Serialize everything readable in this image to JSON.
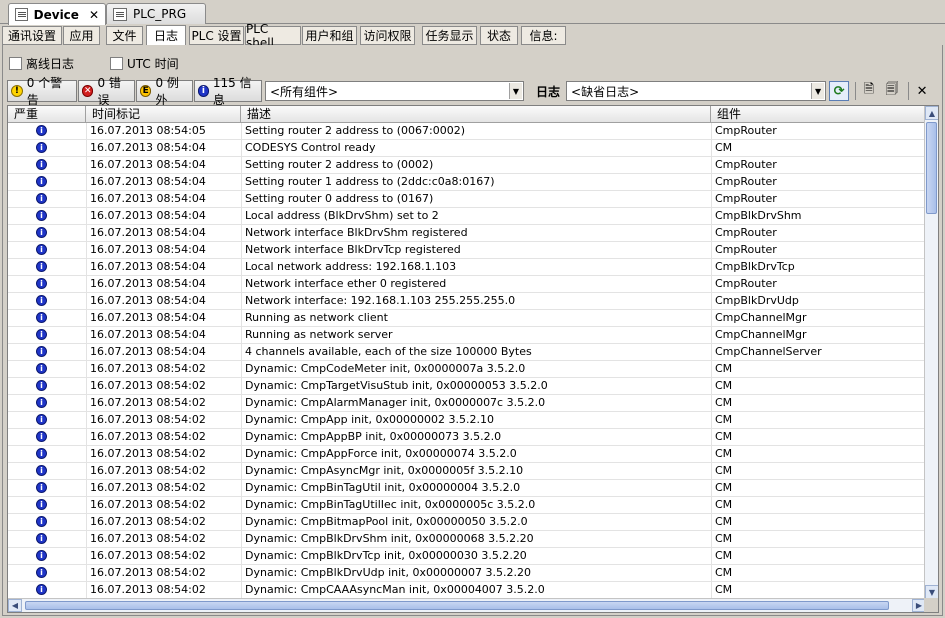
{
  "doc_tabs": [
    {
      "label": "Device",
      "close": "✕"
    },
    {
      "label": "PLC_PRG"
    }
  ],
  "inner_tabs": [
    "通讯设置",
    "应用",
    "文件",
    "日志",
    "PLC 设置",
    "PLC shell",
    "用户和组",
    "访问权限",
    "任务显示",
    "状态",
    "信息:"
  ],
  "active_inner_tab": "日志",
  "options": {
    "offline_log_label": "离线日志",
    "utc_time_label": "UTC 时间"
  },
  "counters": {
    "warnings": "0 个警告",
    "errors": "0 错误",
    "exceptions": "0 例外",
    "info": "115 信息"
  },
  "filter": {
    "component_value": "<所有组件>",
    "log_label": "日志",
    "log_value": "<缺省日志>"
  },
  "columns": [
    "严重",
    "时间标记",
    "描述",
    "组件"
  ],
  "colors": {
    "info_icon": "#1f35c8",
    "panel": "#d4d0c8"
  },
  "rows": [
    {
      "sev": "i",
      "time": "16.07.2013 08:54:05",
      "desc": "Setting router 2 address to (0067:0002)",
      "comp": "CmpRouter"
    },
    {
      "sev": "i",
      "time": "16.07.2013 08:54:04",
      "desc": "CODESYS Control ready",
      "comp": "CM"
    },
    {
      "sev": "i",
      "time": "16.07.2013 08:54:04",
      "desc": "Setting router 2 address to (0002)",
      "comp": "CmpRouter"
    },
    {
      "sev": "i",
      "time": "16.07.2013 08:54:04",
      "desc": "Setting router 1 address to (2ddc:c0a8:0167)",
      "comp": "CmpRouter"
    },
    {
      "sev": "i",
      "time": "16.07.2013 08:54:04",
      "desc": "Setting router 0 address to (0167)",
      "comp": "CmpRouter"
    },
    {
      "sev": "i",
      "time": "16.07.2013 08:54:04",
      "desc": "Local address (BlkDrvShm) set to 2",
      "comp": "CmpBlkDrvShm"
    },
    {
      "sev": "i",
      "time": "16.07.2013 08:54:04",
      "desc": "Network interface BlkDrvShm registered",
      "comp": "CmpRouter"
    },
    {
      "sev": "i",
      "time": "16.07.2013 08:54:04",
      "desc": "Network interface BlkDrvTcp registered",
      "comp": "CmpRouter"
    },
    {
      "sev": "i",
      "time": "16.07.2013 08:54:04",
      "desc": "Local network address: 192.168.1.103",
      "comp": "CmpBlkDrvTcp"
    },
    {
      "sev": "i",
      "time": "16.07.2013 08:54:04",
      "desc": "Network interface ether 0 registered",
      "comp": "CmpRouter"
    },
    {
      "sev": "i",
      "time": "16.07.2013 08:54:04",
      "desc": "Network interface: 192.168.1.103 255.255.255.0",
      "comp": "CmpBlkDrvUdp"
    },
    {
      "sev": "i",
      "time": "16.07.2013 08:54:04",
      "desc": "Running as network client",
      "comp": "CmpChannelMgr"
    },
    {
      "sev": "i",
      "time": "16.07.2013 08:54:04",
      "desc": "Running as network server",
      "comp": "CmpChannelMgr"
    },
    {
      "sev": "i",
      "time": "16.07.2013 08:54:04",
      "desc": "4 channels available, each of the size 100000 Bytes",
      "comp": "CmpChannelServer"
    },
    {
      "sev": "i",
      "time": "16.07.2013 08:54:02",
      "desc": "Dynamic: CmpCodeMeter init, 0x0000007a 3.5.2.0",
      "comp": "CM"
    },
    {
      "sev": "i",
      "time": "16.07.2013 08:54:02",
      "desc": "Dynamic: CmpTargetVisuStub init, 0x00000053 3.5.2.0",
      "comp": "CM"
    },
    {
      "sev": "i",
      "time": "16.07.2013 08:54:02",
      "desc": "Dynamic: CmpAlarmManager init, 0x0000007c 3.5.2.0",
      "comp": "CM"
    },
    {
      "sev": "i",
      "time": "16.07.2013 08:54:02",
      "desc": "Dynamic: CmpApp init, 0x00000002 3.5.2.10",
      "comp": "CM"
    },
    {
      "sev": "i",
      "time": "16.07.2013 08:54:02",
      "desc": "Dynamic: CmpAppBP init, 0x00000073 3.5.2.0",
      "comp": "CM"
    },
    {
      "sev": "i",
      "time": "16.07.2013 08:54:02",
      "desc": "Dynamic: CmpAppForce init, 0x00000074 3.5.2.0",
      "comp": "CM"
    },
    {
      "sev": "i",
      "time": "16.07.2013 08:54:02",
      "desc": "Dynamic: CmpAsyncMgr init, 0x0000005f 3.5.2.10",
      "comp": "CM"
    },
    {
      "sev": "i",
      "time": "16.07.2013 08:54:02",
      "desc": "Dynamic: CmpBinTagUtil init, 0x00000004 3.5.2.0",
      "comp": "CM"
    },
    {
      "sev": "i",
      "time": "16.07.2013 08:54:02",
      "desc": "Dynamic: CmpBinTagUtilIec init, 0x0000005c 3.5.2.0",
      "comp": "CM"
    },
    {
      "sev": "i",
      "time": "16.07.2013 08:54:02",
      "desc": "Dynamic: CmpBitmapPool init, 0x00000050 3.5.2.0",
      "comp": "CM"
    },
    {
      "sev": "i",
      "time": "16.07.2013 08:54:02",
      "desc": "Dynamic: CmpBlkDrvShm init, 0x00000068 3.5.2.20",
      "comp": "CM"
    },
    {
      "sev": "i",
      "time": "16.07.2013 08:54:02",
      "desc": "Dynamic: CmpBlkDrvTcp init, 0x00000030 3.5.2.20",
      "comp": "CM"
    },
    {
      "sev": "i",
      "time": "16.07.2013 08:54:02",
      "desc": "Dynamic: CmpBlkDrvUdp init, 0x00000007 3.5.2.20",
      "comp": "CM"
    },
    {
      "sev": "i",
      "time": "16.07.2013 08:54:02",
      "desc": "Dynamic: CmpCAAAsyncMan init, 0x00004007 3.5.2.0",
      "comp": "CM"
    }
  ]
}
